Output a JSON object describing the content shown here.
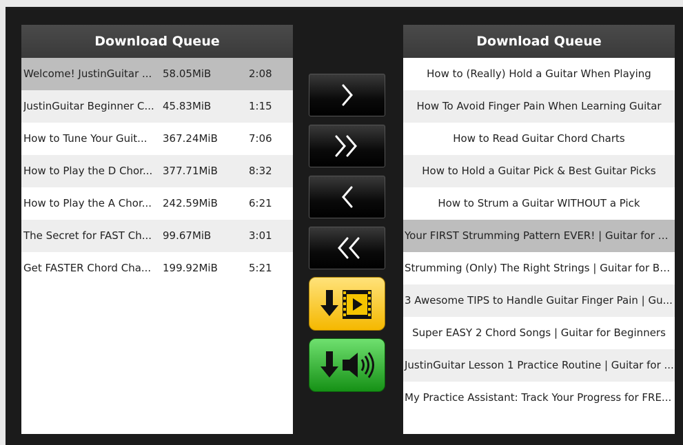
{
  "left_panel": {
    "title": "Download Queue",
    "rows": [
      {
        "name": "Welcome! JustinGuitar ...",
        "size": "58.05MiB",
        "duration": "2:08",
        "selected": true
      },
      {
        "name": "JustinGuitar Beginner C...",
        "size": "45.83MiB",
        "duration": "1:15"
      },
      {
        "name": "How to Tune Your Guit...",
        "size": "367.24MiB",
        "duration": "7:06"
      },
      {
        "name": "How to Play the D Chor...",
        "size": "377.71MiB",
        "duration": "8:32"
      },
      {
        "name": "How to Play the A Chor...",
        "size": "242.59MiB",
        "duration": "6:21"
      },
      {
        "name": "The Secret for FAST Ch...",
        "size": "99.67MiB",
        "duration": "3:01"
      },
      {
        "name": "Get FASTER Chord Cha...",
        "size": "199.92MiB",
        "duration": "5:21"
      }
    ]
  },
  "right_panel": {
    "title": "Download Queue",
    "rows": [
      {
        "title": "How to (Really) Hold a Guitar When Playing"
      },
      {
        "title": "How To Avoid Finger Pain When Learning Guitar"
      },
      {
        "title": "How to Read Guitar Chord Charts"
      },
      {
        "title": "How to Hold a Guitar Pick & Best Guitar Picks"
      },
      {
        "title": "How to Strum a Guitar WITHOUT a Pick"
      },
      {
        "title": "Your FIRST Strumming Pattern EVER! | Guitar for B...",
        "selected": true
      },
      {
        "title": "Strumming (Only) The Right Strings | Guitar for Be..."
      },
      {
        "title": "3 Awesome TIPS to Handle Guitar Finger Pain | Gu..."
      },
      {
        "title": "Super EASY 2 Chord Songs | Guitar for Beginners"
      },
      {
        "title": "JustinGuitar Lesson 1 Practice Routine | Guitar for ..."
      },
      {
        "title": "My Practice Assistant: Track Your Progress for FRE..."
      }
    ]
  },
  "controls": {
    "move_right_icon": "single-chevron-right",
    "move_all_right_icon": "double-chevron-right",
    "move_left_icon": "single-chevron-left",
    "move_all_left_icon": "double-chevron-left",
    "download_video_icon": "download-video-icon",
    "download_audio_icon": "download-audio-icon"
  },
  "colors": {
    "background": "#1b1b1b",
    "header": "#404040",
    "row_alt": "#eeeeee",
    "row_selected": "#bdbdbd",
    "video_button": "#f5b800",
    "audio_button": "#169116"
  }
}
